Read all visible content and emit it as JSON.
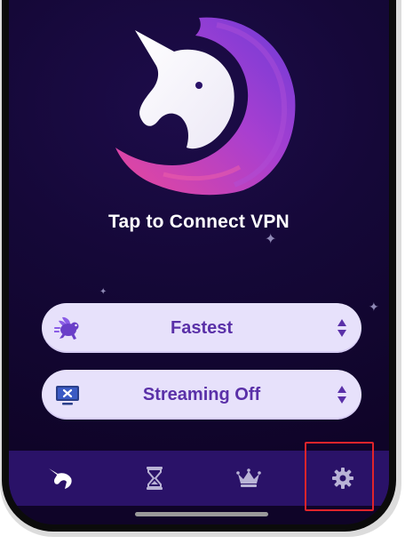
{
  "main": {
    "connect_label": "Tap to Connect VPN"
  },
  "selectors": {
    "server": {
      "label": "Fastest",
      "icon": "rabbit-icon"
    },
    "streaming": {
      "label": "Streaming Off",
      "icon": "tv-icon"
    }
  },
  "bottom_nav": {
    "items": [
      {
        "icon": "unicorn-home-icon",
        "active": true
      },
      {
        "icon": "hourglass-icon",
        "active": false
      },
      {
        "icon": "crown-icon",
        "active": false
      },
      {
        "icon": "gear-icon",
        "active": false
      }
    ]
  },
  "colors": {
    "background": "#150838",
    "pill_background": "#e7e1fb",
    "pill_text": "#5a30a8",
    "nav_background": "#2a1268",
    "logo_gradient_start": "#e8479b",
    "logo_gradient_end": "#6d3bd8",
    "highlight": "#e0242b"
  }
}
